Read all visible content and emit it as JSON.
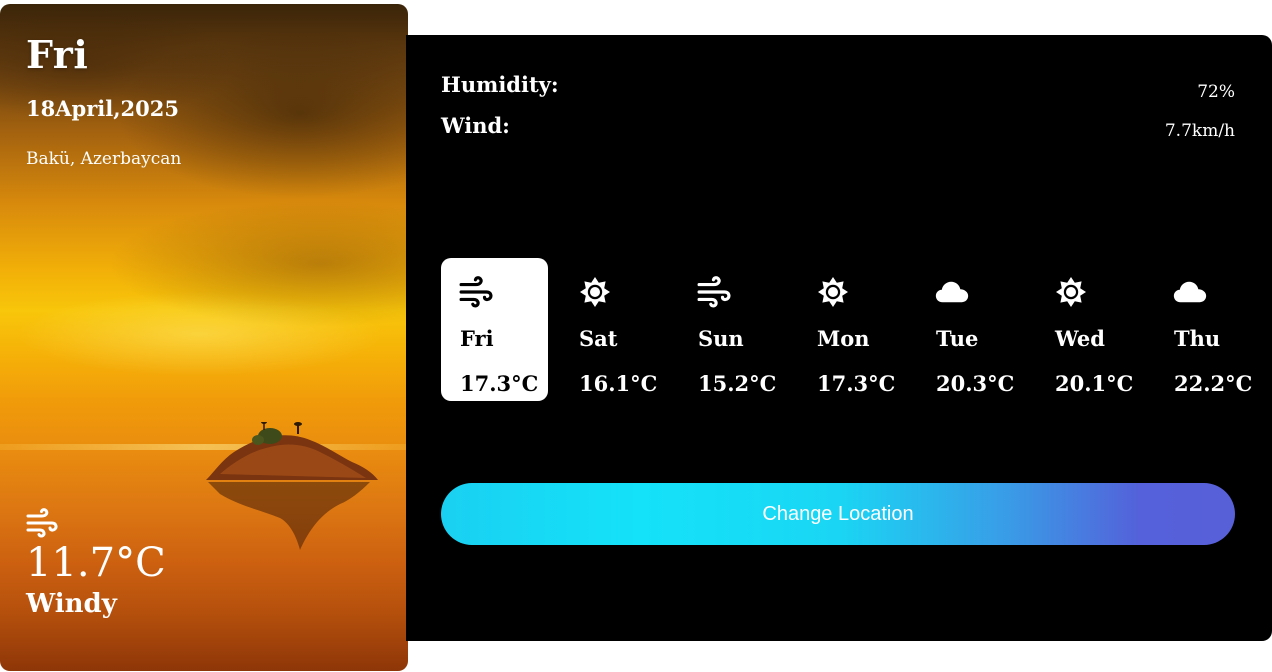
{
  "current": {
    "day": "Fri",
    "date": "18April,2025",
    "location": "Bakü, Azerbaycan",
    "icon": "wind-icon",
    "temperature": "11.7°C",
    "description": "Windy"
  },
  "stats": {
    "humidity_label": "Humidity:",
    "humidity_value": "72%",
    "wind_label": "Wind:",
    "wind_value": "7.7km/h"
  },
  "forecast": [
    {
      "day": "Fri",
      "temp": "17.3°C",
      "icon": "wind-icon",
      "active": true
    },
    {
      "day": "Sat",
      "temp": "16.1°C",
      "icon": "sun-icon",
      "active": false
    },
    {
      "day": "Sun",
      "temp": "15.2°C",
      "icon": "wind-icon",
      "active": false
    },
    {
      "day": "Mon",
      "temp": "17.3°C",
      "icon": "sun-icon",
      "active": false
    },
    {
      "day": "Tue",
      "temp": "20.3°C",
      "icon": "cloud-icon",
      "active": false
    },
    {
      "day": "Wed",
      "temp": "20.1°C",
      "icon": "sun-icon",
      "active": false
    },
    {
      "day": "Thu",
      "temp": "22.2°C",
      "icon": "cloud-icon",
      "active": false
    }
  ],
  "actions": {
    "change_location_label": "Change Location"
  },
  "colors": {
    "panel_bg": "#000000",
    "active_card_bg": "#ffffff",
    "button_gradient_start": "#14e2f8",
    "button_gradient_end": "#5860d8"
  }
}
